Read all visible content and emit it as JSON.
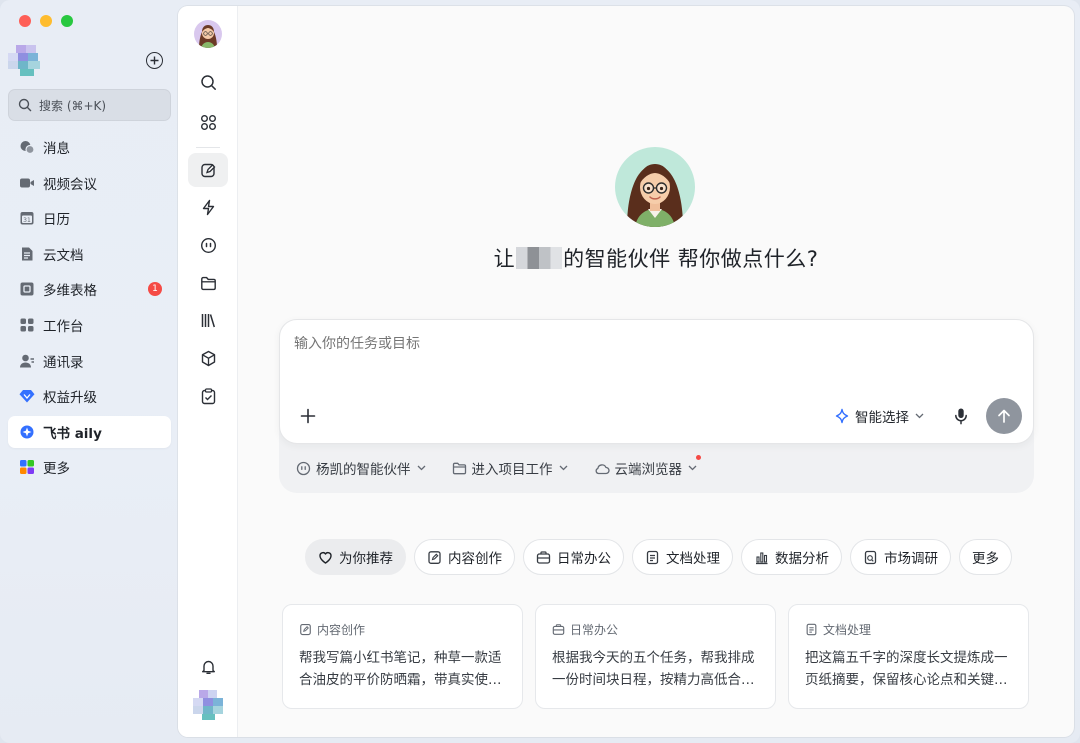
{
  "window": {
    "traffic_lights": [
      "close",
      "minimize",
      "zoom"
    ]
  },
  "sidebar": {
    "search_label": "搜索 (⌘+K)",
    "items": [
      {
        "label": "消息",
        "icon": "chat-bubbles-icon"
      },
      {
        "label": "视频会议",
        "icon": "video-camera-icon"
      },
      {
        "label": "日历",
        "icon": "calendar-icon"
      },
      {
        "label": "云文档",
        "icon": "cloud-doc-icon"
      },
      {
        "label": "多维表格",
        "icon": "base-table-icon",
        "badge": "1"
      },
      {
        "label": "工作台",
        "icon": "workplace-grid-icon"
      },
      {
        "label": "通讯录",
        "icon": "contacts-icon"
      },
      {
        "label": "权益升级",
        "icon": "diamond-icon"
      },
      {
        "label": "飞书 aily",
        "icon": "aily-icon",
        "active": true
      },
      {
        "label": "更多",
        "icon": "more-apps-icon"
      }
    ]
  },
  "rail": {
    "icons": [
      "search-icon",
      "apps-icon",
      "new-chat-icon",
      "lightning-icon",
      "agent-face-icon",
      "folder-icon",
      "library-icon",
      "cube-icon",
      "clipboard-check-icon",
      "bell-icon"
    ]
  },
  "hero": {
    "title_prefix": "让",
    "title_suffix": "的智能伙伴 帮你做点什么?"
  },
  "composer": {
    "placeholder": "输入你的任务或目标",
    "smart_select_label": "智能选择",
    "sub_options": [
      {
        "label": "杨凯的智能伙伴",
        "icon": "agent-face-icon"
      },
      {
        "label": "进入项目工作",
        "icon": "folder-icon"
      },
      {
        "label": "云端浏览器",
        "icon": "cloud-icon",
        "dot": true
      }
    ]
  },
  "chips": [
    {
      "label": "为你推荐",
      "icon": "heart-icon",
      "active": true
    },
    {
      "label": "内容创作",
      "icon": "edit-doc-icon"
    },
    {
      "label": "日常办公",
      "icon": "briefcase-icon"
    },
    {
      "label": "文档处理",
      "icon": "document-icon"
    },
    {
      "label": "数据分析",
      "icon": "bar-chart-icon"
    },
    {
      "label": "市场调研",
      "icon": "research-icon"
    },
    {
      "label": "更多"
    }
  ],
  "cards": [
    {
      "tag": "内容创作",
      "text": "帮我写篇小红书笔记，种草一款适合油皮的平价防晒霜，带真实使用感受"
    },
    {
      "tag": "日常办公",
      "text": "根据我今天的五个任务，帮我排成一份时间块日程，按精力高低合理安排"
    },
    {
      "tag": "文档处理",
      "text": "把这篇五千字的深度长文提炼成一页纸摘要，保留核心论点和关键数据"
    }
  ],
  "colors": {
    "accent": "#3370ff",
    "badge": "#f54a45",
    "send_button": "#8f959e"
  }
}
